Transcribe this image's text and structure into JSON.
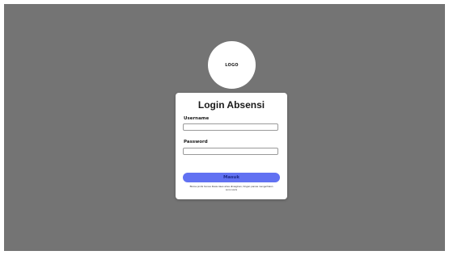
{
  "logo": {
    "text": "LOGO"
  },
  "login_card": {
    "title": "Login Absensi",
    "username_label": "Username",
    "username_value": "",
    "username_placeholder": "",
    "password_label": "Password",
    "password_value": "",
    "password_placeholder": "",
    "submit_label": "Masuk",
    "footnote": "Bisma pmrik homes illesie tiaes atres dimaginan, hingan pamas mengerhiasn sonu socis"
  },
  "colors": {
    "background": "#747474",
    "card": "#ffffff",
    "button": "#6171f2",
    "button_text": "#1e2a8a"
  }
}
